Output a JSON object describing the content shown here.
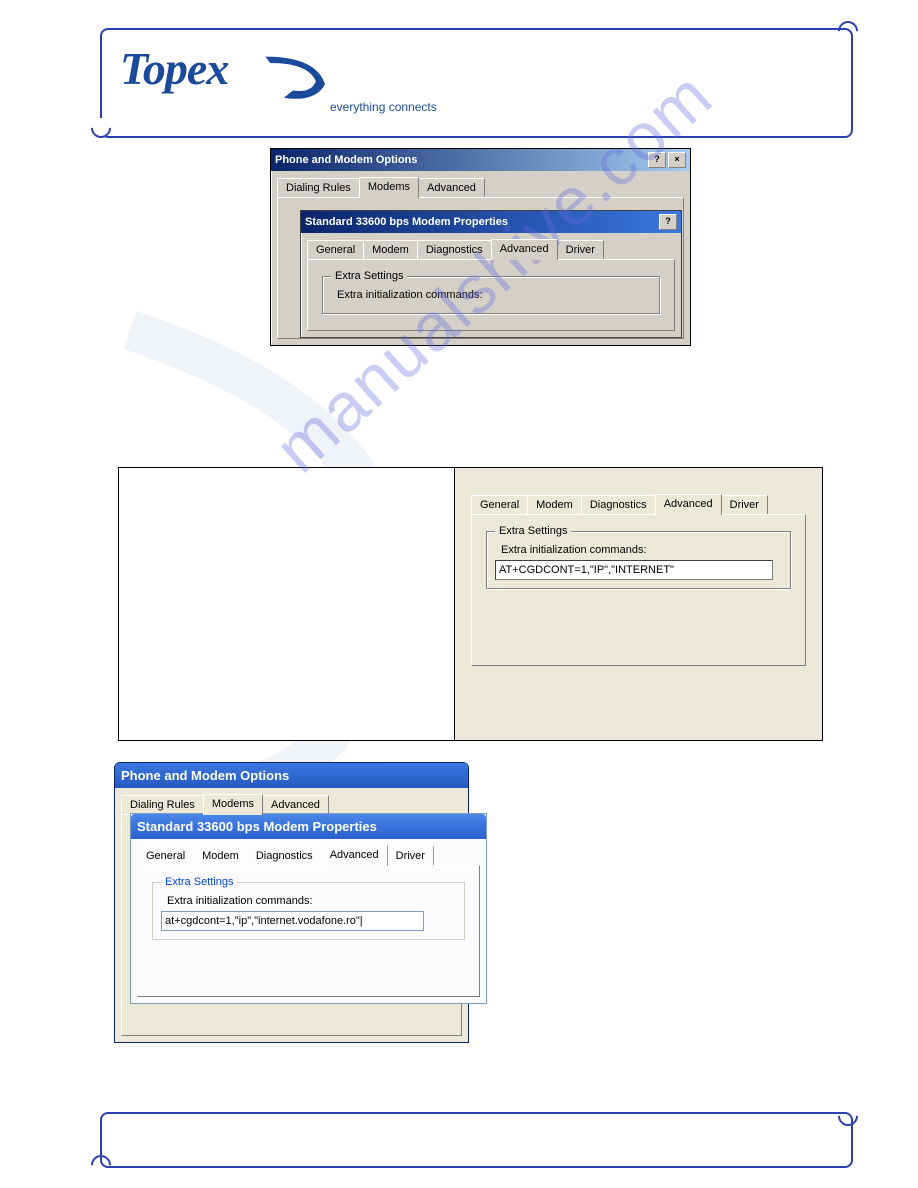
{
  "logo": {
    "brand": "Topex",
    "tagline": "everything connects"
  },
  "dlg1": {
    "title": "Phone and Modem Options",
    "help_btn": "?",
    "close_btn": "×",
    "tabs": [
      "Dialing Rules",
      "Modems",
      "Advanced"
    ],
    "active_tab": "Modems"
  },
  "dlg1_inner": {
    "title": "Standard 33600 bps Modem Properties",
    "tabs": [
      "General",
      "Modem",
      "Diagnostics",
      "Advanced",
      "Driver"
    ],
    "active_tab": "Advanced",
    "group_legend": "Extra Settings",
    "field_label": "Extra initialization commands:"
  },
  "dlg2": {
    "tabs": [
      "General",
      "Modem",
      "Diagnostics",
      "Advanced",
      "Driver"
    ],
    "active_tab": "Advanced",
    "group_legend": "Extra Settings",
    "field_label": "Extra initialization commands:",
    "field_value": "AT+CGDCONT=1,\"IP\",\"INTERNET\""
  },
  "dlg3": {
    "title": "Phone and Modem Options",
    "tabs": [
      "Dialing Rules",
      "Modems",
      "Advanced"
    ],
    "active_tab": "Modems"
  },
  "dlg3_inner": {
    "title": "Standard 33600 bps Modem Properties",
    "tabs": [
      "General",
      "Modem",
      "Diagnostics",
      "Advanced",
      "Driver"
    ],
    "active_tab": "Advanced",
    "group_legend": "Extra Settings",
    "field_label": "Extra initialization commands:",
    "field_value": "at+cgdcont=1,\"ip\",\"internet.vodafone.ro\"|"
  },
  "watermark": "manualshive.com"
}
